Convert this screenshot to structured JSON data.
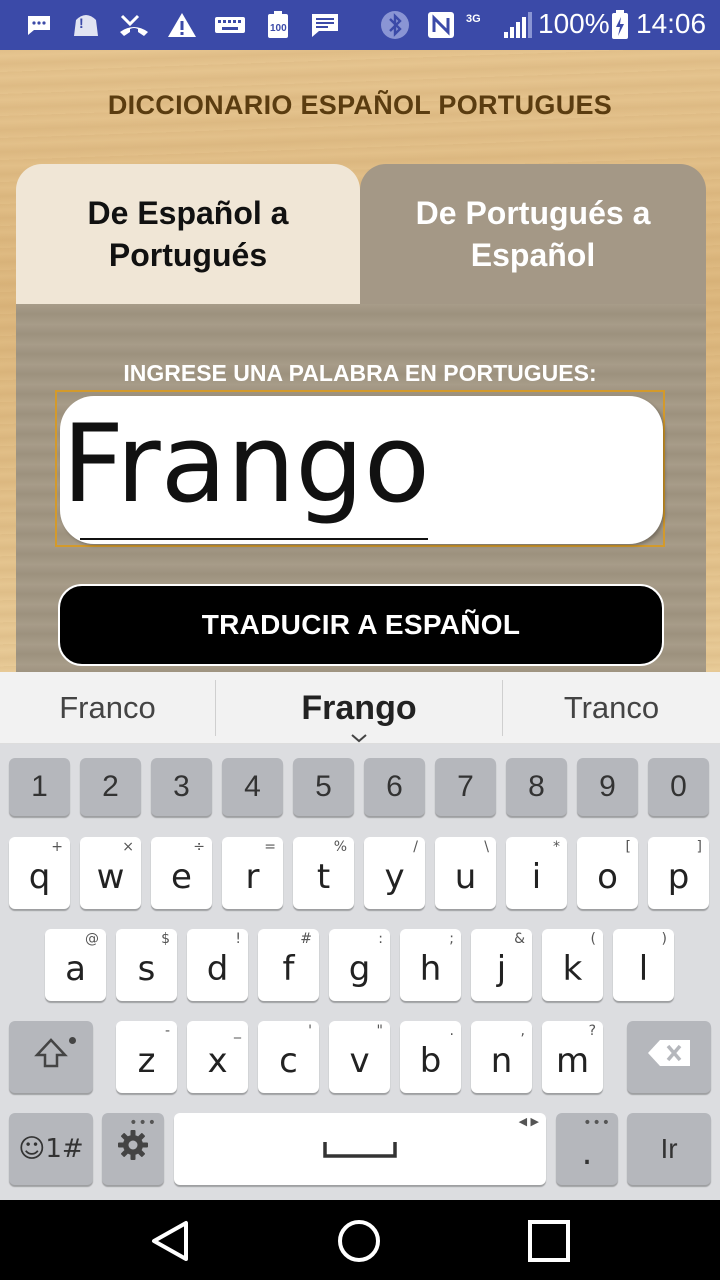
{
  "status_bar": {
    "icons": [
      "sms-icon",
      "face-icon",
      "missed-call-icon",
      "warning-icon",
      "keyboard-icon",
      "battery-saver-icon",
      "message-icon",
      "bluetooth-icon",
      "nfc-icon",
      "signal-3g-icon",
      "battery-charging-icon"
    ],
    "network_label": "3G",
    "battery_text": "100%",
    "time": "14:06"
  },
  "app": {
    "title": "DICCIONARIO ESPAÑOL PORTUGUES",
    "tabs": [
      {
        "label": "De Español a Portugués",
        "selected": false
      },
      {
        "label": "De Portugués a Español",
        "selected": true
      }
    ],
    "prompt": "INGRESE UNA PALABRA EN PORTUGUES:",
    "input_value": "Frango",
    "translate_button": "TRADUCIR A ESPAÑOL"
  },
  "suggestions": [
    "Franco",
    "Frango",
    "Tranco"
  ],
  "keyboard": {
    "numbers": [
      "1",
      "2",
      "3",
      "4",
      "5",
      "6",
      "7",
      "8",
      "9",
      "0"
    ],
    "row1": [
      {
        "k": "q",
        "h": "+"
      },
      {
        "k": "w",
        "h": "×"
      },
      {
        "k": "e",
        "h": "÷"
      },
      {
        "k": "r",
        "h": "="
      },
      {
        "k": "t",
        "h": "%"
      },
      {
        "k": "y",
        "h": "/"
      },
      {
        "k": "u",
        "h": "\\"
      },
      {
        "k": "i",
        "h": "*"
      },
      {
        "k": "o",
        "h": "["
      },
      {
        "k": "p",
        "h": "]"
      }
    ],
    "row2": [
      {
        "k": "a",
        "h": "@"
      },
      {
        "k": "s",
        "h": "$"
      },
      {
        "k": "d",
        "h": "!"
      },
      {
        "k": "f",
        "h": "#"
      },
      {
        "k": "g",
        "h": ":"
      },
      {
        "k": "h",
        "h": ";"
      },
      {
        "k": "j",
        "h": "&"
      },
      {
        "k": "k",
        "h": "("
      },
      {
        "k": "l",
        "h": ")"
      }
    ],
    "row3": [
      {
        "k": "z",
        "h": "-"
      },
      {
        "k": "x",
        "h": "_"
      },
      {
        "k": "c",
        "h": "'"
      },
      {
        "k": "v",
        "h": "\""
      },
      {
        "k": "b",
        "h": "."
      },
      {
        "k": "n",
        "h": ","
      },
      {
        "k": "m",
        "h": "?"
      }
    ],
    "emoji_key": "☺1#",
    "period_key": ".",
    "enter_key": "Ir"
  },
  "nav": [
    "back-icon",
    "home-icon",
    "recents-icon"
  ]
}
